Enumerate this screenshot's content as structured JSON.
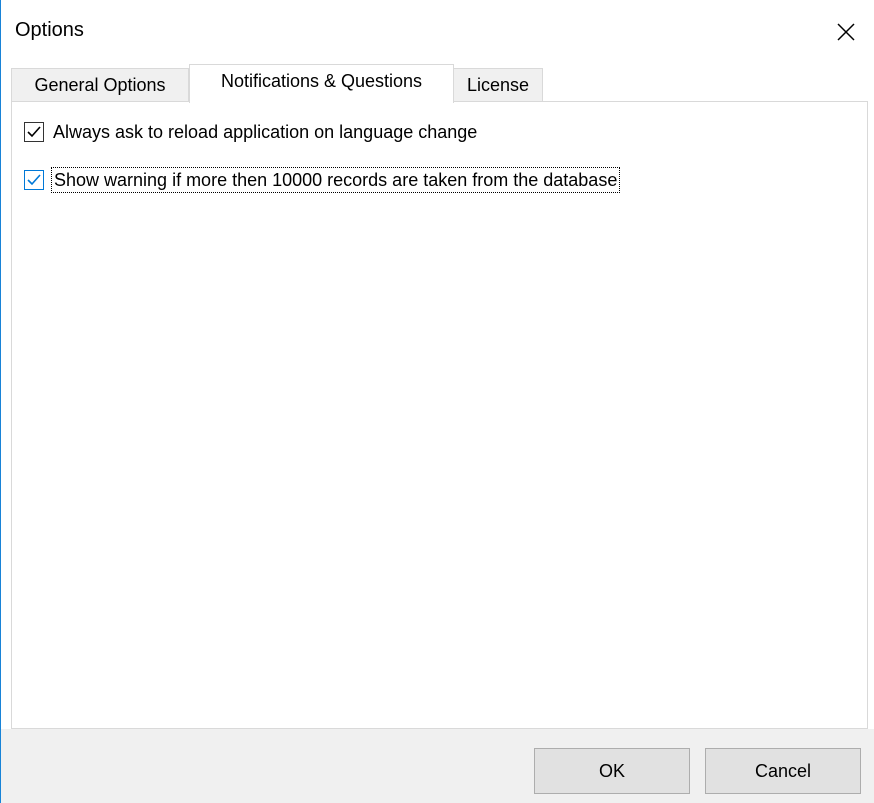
{
  "window": {
    "title": "Options",
    "close_icon": "close-icon"
  },
  "tabs": [
    {
      "label": "General Options",
      "active": false
    },
    {
      "label": "Notifications & Questions",
      "active": true
    },
    {
      "label": "License",
      "active": false
    }
  ],
  "options": [
    {
      "label": "Always ask to reload application on language change",
      "checked": true
    },
    {
      "label": "Show warning if more then 10000 records are taken from the database",
      "checked": true,
      "focused": true
    }
  ],
  "buttons": {
    "ok_label": "OK",
    "cancel_label": "Cancel"
  },
  "colors": {
    "accent": "#0078d7",
    "window_border": "#1883d7",
    "footer_bg": "#f0f0f0",
    "button_bg": "#e1e1e1"
  }
}
